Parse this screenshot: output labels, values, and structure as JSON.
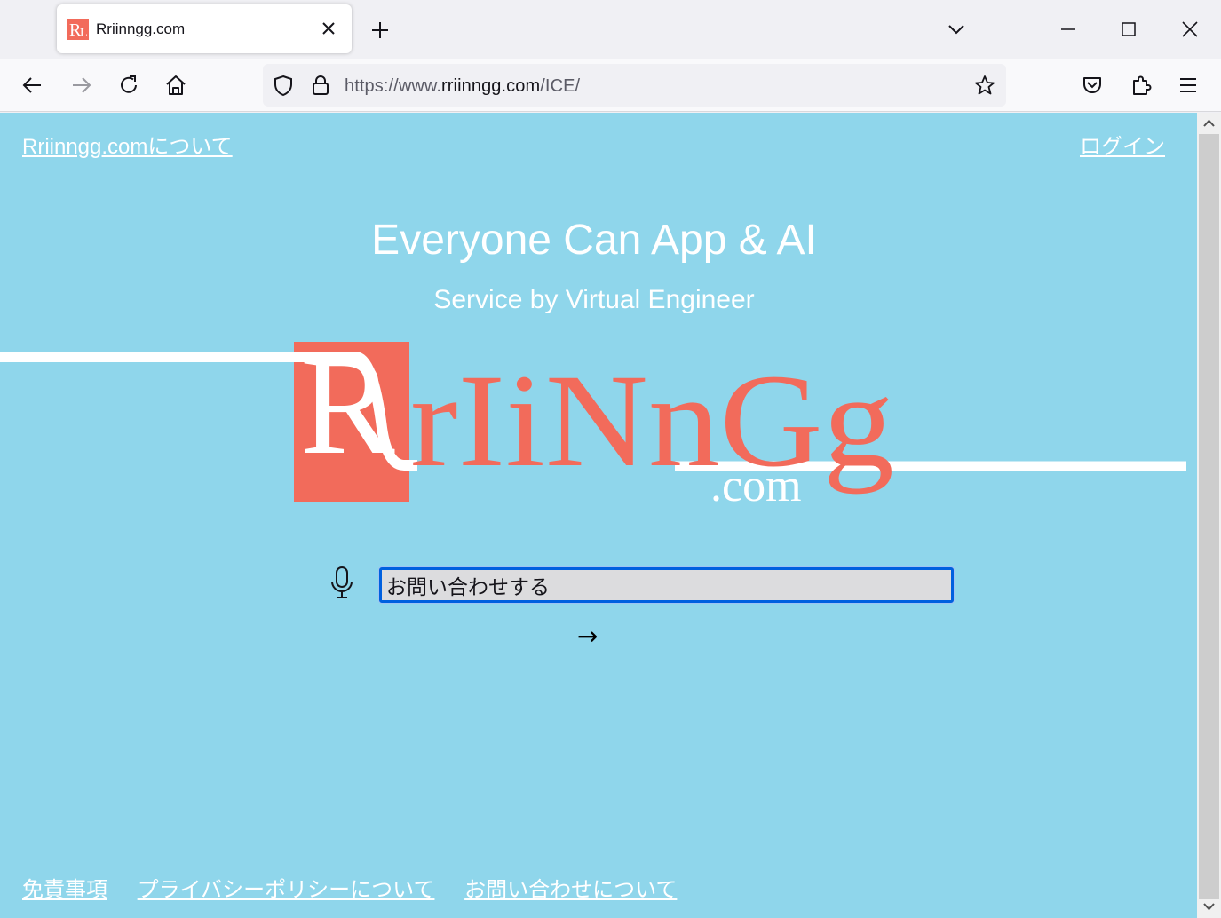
{
  "browser": {
    "tab_title": "Rriinngg.com",
    "url_prefix": "https://www.",
    "url_host": "rriinngg.com",
    "url_path": "/ICE/"
  },
  "page": {
    "about_link": "Rriinngg.comについて",
    "login_link": "ログイン",
    "headline": "Everyone Can App & AI",
    "subline": "Service by Virtual Engineer",
    "logo": {
      "big_letter": "R",
      "letters": "rIiNnGg",
      "domain": ".com",
      "accent_color": "#f26b5b"
    },
    "inquiry": {
      "value": "お問い合わせする"
    },
    "submit_label": "→",
    "footer": [
      {
        "label": "免責事項"
      },
      {
        "label": "プライバシーポリシーについて"
      },
      {
        "label": "お問い合わせについて"
      }
    ],
    "background_color": "#8fd6eb"
  }
}
